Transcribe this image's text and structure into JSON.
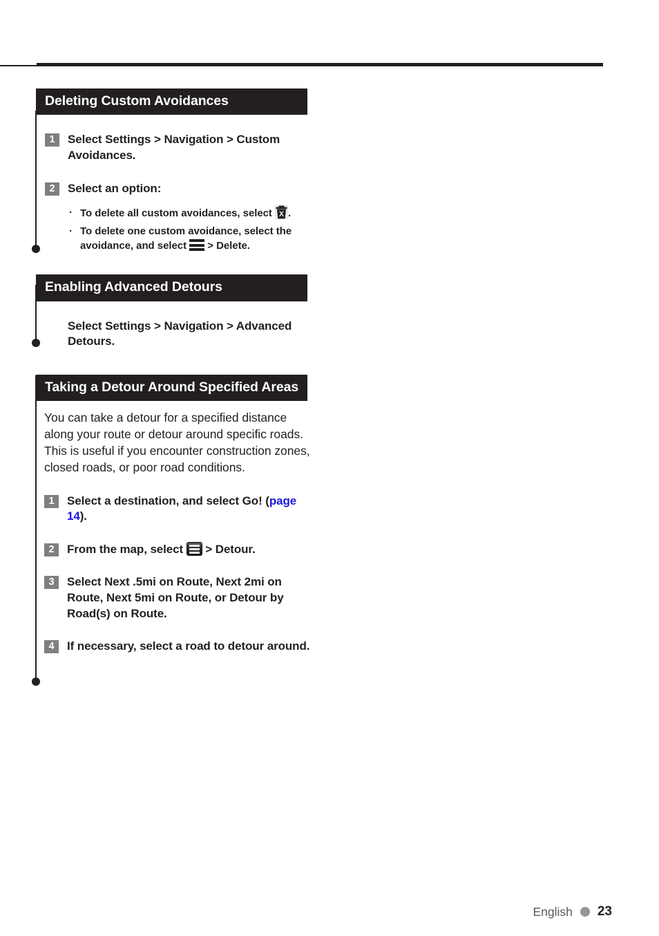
{
  "page": {
    "footer": {
      "language": "English",
      "page_number": "23",
      "separator_icon": "filled-circle"
    }
  },
  "sections": [
    {
      "id": "deleting-custom-avoidances",
      "title": "Deleting Custom Avoidances",
      "steps": [
        {
          "number": "1",
          "text": "Select Settings > Navigation > Custom Avoidances."
        },
        {
          "number": "2",
          "text": "Select an option:",
          "bullets": [
            {
              "before": "To delete all custom avoidances, select ",
              "icon": "trash-delete-all-icon",
              "after": "."
            },
            {
              "before": "To delete one custom avoidance, select the avoidance, and select ",
              "icon": "hamburger-menu-icon",
              "after": " > Delete."
            }
          ]
        }
      ]
    },
    {
      "id": "enabling-advanced-detours",
      "title": "Enabling Advanced Detours",
      "plain_step": "Select Settings > Navigation > Advanced Detours."
    },
    {
      "id": "taking-a-detour-around-specified-areas",
      "title": "Taking a Detour Around Specified Areas",
      "paragraph": "You can take a detour for a specified distance along your route or detour around specific roads. This is useful if you encounter construction zones, closed roads, or poor road conditions.",
      "steps": [
        {
          "number": "1",
          "text_before_link": "Select a destination, and select Go! (",
          "link_text": "page 14",
          "text_after_link": ")."
        },
        {
          "number": "2",
          "text_before_icon": "From the map, select ",
          "icon": "menu-button-icon",
          "text_after_icon": " > Detour."
        },
        {
          "number": "3",
          "text": "Select Next .5mi on Route, Next 2mi on Route, Next 5mi on Route, or Detour by Road(s) on Route."
        },
        {
          "number": "4",
          "text": "If necessary, select a road to detour around."
        }
      ]
    }
  ],
  "colors": {
    "header_bar": "#231f20",
    "step_badge": "#7f7f7f",
    "link": "#1a19e0",
    "footer_dot": "#939598",
    "footer_text": "#58595b"
  }
}
